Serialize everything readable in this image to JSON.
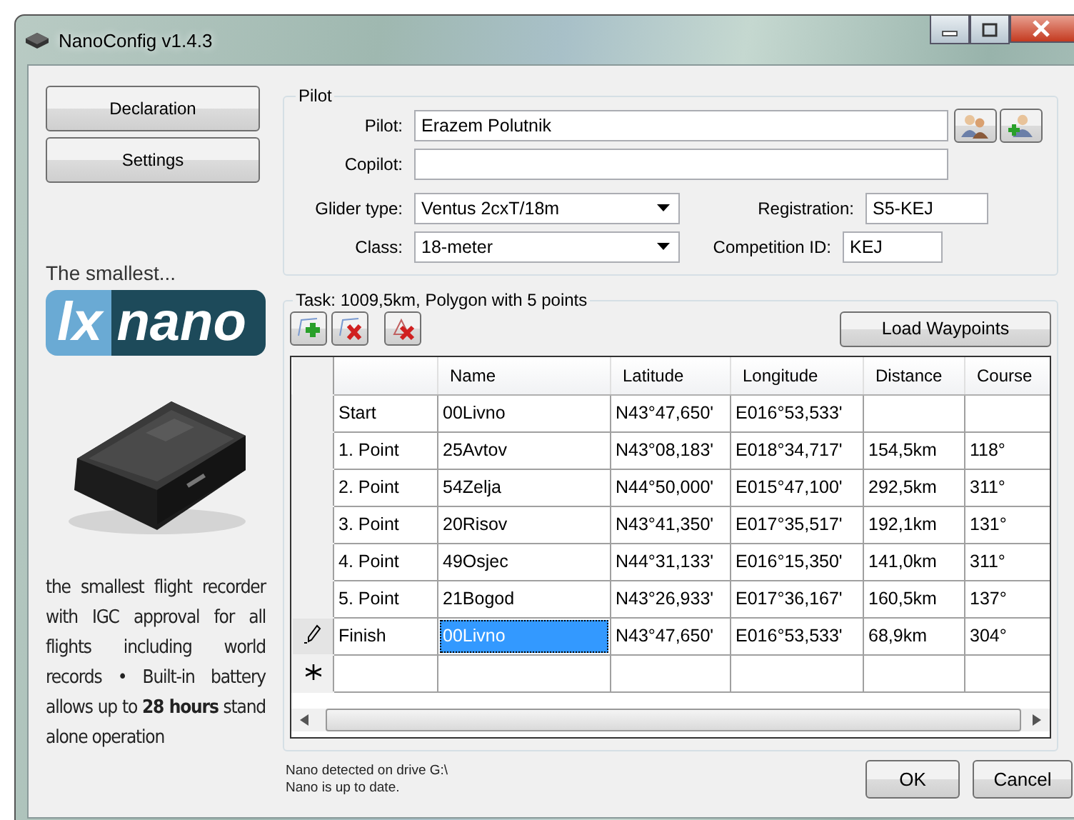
{
  "window": {
    "title": "NanoConfig v1.4.3"
  },
  "sidebar": {
    "buttons": [
      "Declaration",
      "Settings"
    ],
    "tagline": "The smallest...",
    "logo": {
      "part_1": "lx",
      "part_2": "nano"
    },
    "description": "the smallest flight recorder with IGC approval for all flights including world records • Built-in battery allows up to **28 hours** stand alone operation"
  },
  "pilot_group": {
    "title": "Pilot",
    "pilot": {
      "label": "Pilot:",
      "value": "Erazem Polutnik"
    },
    "copilot": {
      "label": "Copilot:"
    },
    "glider_type": {
      "label": "Glider type:",
      "value": "Ventus 2cxT/18m"
    },
    "registration": {
      "label": "Registration:",
      "value": "S5-KEJ"
    },
    "class": {
      "label": "Class:",
      "value": "18-meter"
    },
    "competition_id": {
      "label": "Competition ID:",
      "value": "KEJ"
    }
  },
  "task_group": {
    "title": "Task: 1009,5km, Polygon with 5 points",
    "load_button": "Load Waypoints",
    "table": {
      "columns": [
        "",
        "Name",
        "Latitude",
        "Longitude",
        "Distance",
        "Course"
      ],
      "rows": [
        {
          "kind": "point",
          "editing": false,
          "cells": [
            {
              "text": "Start",
              "selected": false
            },
            {
              "text": "00Livno",
              "selected": false
            },
            {
              "text": "N43°47,650'",
              "selected": false
            },
            {
              "text": "E016°53,533'",
              "selected": false
            }
          ]
        },
        {
          "kind": "point",
          "editing": false,
          "cells": [
            {
              "text": "1. Point",
              "selected": false
            },
            {
              "text": "25Avtov",
              "selected": false
            },
            {
              "text": "N43°08,183'",
              "selected": false
            },
            {
              "text": "E018°34,717'",
              "selected": false
            },
            {
              "text": "154,5km",
              "selected": false
            },
            {
              "text": "118°",
              "selected": false
            }
          ]
        },
        {
          "kind": "point",
          "editing": false,
          "cells": [
            {
              "text": "2. Point",
              "selected": false
            },
            {
              "text": "54Zelja",
              "selected": false
            },
            {
              "text": "N44°50,000'",
              "selected": false
            },
            {
              "text": "E015°47,100'",
              "selected": false
            },
            {
              "text": "292,5km",
              "selected": false
            },
            {
              "text": "311°",
              "selected": false
            }
          ]
        },
        {
          "kind": "point",
          "editing": false,
          "cells": [
            {
              "text": "3. Point",
              "selected": false
            },
            {
              "text": "20Risov",
              "selected": false
            },
            {
              "text": "N43°41,350'",
              "selected": false
            },
            {
              "text": "E017°35,517'",
              "selected": false
            },
            {
              "text": "192,1km",
              "selected": false
            },
            {
              "text": "131°",
              "selected": false
            }
          ]
        },
        {
          "kind": "point",
          "editing": false,
          "cells": [
            {
              "text": "4. Point",
              "selected": false
            },
            {
              "text": "49Osjec",
              "selected": false
            },
            {
              "text": "N44°31,133'",
              "selected": false
            },
            {
              "text": "E016°15,350'",
              "selected": false
            },
            {
              "text": "141,0km",
              "selected": false
            },
            {
              "text": "311°",
              "selected": false
            }
          ]
        },
        {
          "kind": "point",
          "editing": false,
          "cells": [
            {
              "text": "5. Point",
              "selected": false
            },
            {
              "text": "21Bogod",
              "selected": false
            },
            {
              "text": "N43°26,933'",
              "selected": false
            },
            {
              "text": "E017°36,167'",
              "selected": false
            },
            {
              "text": "160,5km",
              "selected": false
            },
            {
              "text": "137°",
              "selected": false
            }
          ]
        },
        {
          "kind": "point",
          "editing": true,
          "cells": [
            {
              "text": "Finish",
              "selected": false
            },
            {
              "text": "00Livno",
              "selected": true
            },
            {
              "text": "N43°47,650'",
              "selected": false
            },
            {
              "text": "E016°53,533'",
              "selected": false
            },
            {
              "text": "68,9km",
              "selected": false
            },
            {
              "text": "304°",
              "selected": false
            }
          ]
        },
        {
          "kind": "new",
          "editing": false,
          "cells": []
        }
      ]
    }
  },
  "status_lines": [
    "Nano detected on drive G:\\",
    "Nano is up to date."
  ],
  "buttons": [
    "OK",
    "Cancel"
  ]
}
